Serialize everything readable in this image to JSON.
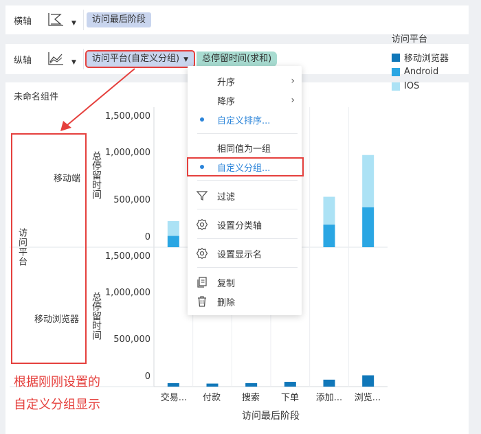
{
  "x_axis_row": {
    "label": "横轴",
    "field": "访问最后阶段"
  },
  "y_axis_row": {
    "label": "纵轴",
    "dim_field": "访问平台(自定义分组)",
    "measure_field": "总停留时间(求和)"
  },
  "component": {
    "title": "未命名组件"
  },
  "context_menu": {
    "items": [
      {
        "label": "升序",
        "submenu": true
      },
      {
        "label": "降序",
        "submenu": true
      },
      {
        "label": "自定义排序...",
        "selected": true
      },
      {
        "label": "相同值为一组"
      },
      {
        "label": "自定义分组...",
        "selected": true
      },
      {
        "label": "过滤",
        "icon": "filter-icon"
      },
      {
        "label": "设置分类轴",
        "icon": "gear-icon"
      },
      {
        "label": "设置显示名",
        "icon": "gear-icon"
      },
      {
        "label": "复制",
        "icon": "copy-icon"
      },
      {
        "label": "删除",
        "icon": "trash-icon"
      }
    ]
  },
  "row_axis": {
    "title": "访问平台",
    "groups": [
      "移动端",
      "移动浏览器"
    ]
  },
  "annotation": {
    "line1": "根据刚刚设置的",
    "line2": "自定义分组显示"
  },
  "colors": {
    "dark": "#1077b9",
    "mid": "#2aa6e3",
    "light": "#ace2f5",
    "highlight": "#e5403d",
    "accent": "#2b84d9"
  },
  "chart_data": {
    "type": "bar",
    "stacked": true,
    "categories": [
      "交易...",
      "付款",
      "搜索",
      "下单",
      "添加...",
      "浏览..."
    ],
    "xlabel": "访问最后阶段",
    "ylabel": "总停留时间",
    "ylim": [
      0,
      1500000
    ],
    "yticks": [
      "1,500,000",
      "1,000,000",
      "500,000",
      "0"
    ],
    "yticks_values": [
      1500000,
      1000000,
      500000,
      0
    ],
    "legend": {
      "title": "访问平台",
      "position": "right",
      "entries": [
        "移动浏览器",
        "Android",
        "IOS"
      ]
    },
    "panels": [
      {
        "group": "移动端",
        "series": [
          {
            "name": "Android",
            "values": [
              130000,
              0,
              0,
              0,
              260000,
              460000
            ]
          },
          {
            "name": "IOS",
            "values": [
              170000,
              0,
              0,
              0,
              320000,
              600000
            ]
          }
        ]
      },
      {
        "group": "移动浏览器",
        "series": [
          {
            "name": "移动浏览器",
            "values": [
              40000,
              35000,
              40000,
              55000,
              80000,
              130000
            ]
          }
        ]
      }
    ]
  }
}
